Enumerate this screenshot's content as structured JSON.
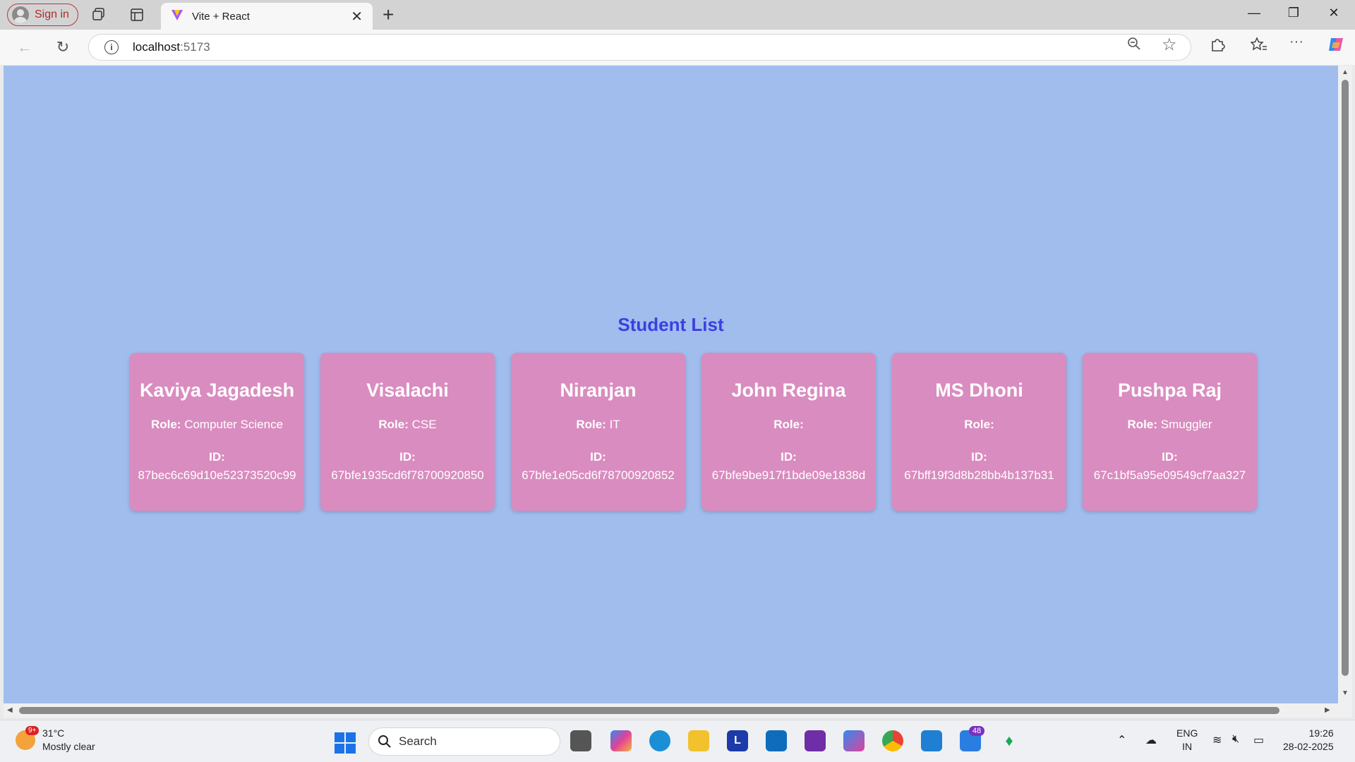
{
  "browser": {
    "signin_label": "Sign in",
    "tab_title": "Vite + React",
    "url_host": "localhost",
    "url_port": ":5173"
  },
  "page": {
    "heading": "Student List",
    "role_label": "Role:",
    "id_label": "ID:",
    "students": [
      {
        "name": "Kaviya Jagadesh",
        "role": "Computer Science",
        "id": "87bec6c69d10e52373520c99"
      },
      {
        "name": "Visalachi",
        "role": "CSE",
        "id": "67bfe1935cd6f78700920850"
      },
      {
        "name": "Niranjan",
        "role": "IT",
        "id": "67bfe1e05cd6f78700920852"
      },
      {
        "name": "John Regina",
        "role": "",
        "id": "67bfe9be917f1bde09e1838d"
      },
      {
        "name": "MS Dhoni",
        "role": "",
        "id": "67bff19f3d8b28bb4b137b31"
      },
      {
        "name": "Pushpa Raj",
        "role": "Smuggler",
        "id": "67c1bf5a95e09549cf7aa327"
      }
    ]
  },
  "taskbar": {
    "weather_temp": "31°C",
    "weather_desc": "Mostly clear",
    "weather_badge": "9+",
    "search_label": "Search",
    "app_badge": "48",
    "lang_1": "ENG",
    "lang_2": "IN",
    "time": "19:26",
    "date": "28-02-2025",
    "letter_app": "L"
  },
  "colors": {
    "page_bg": "#a0bdee",
    "card_bg": "#d98cbf",
    "heading": "#3d3fe0"
  }
}
